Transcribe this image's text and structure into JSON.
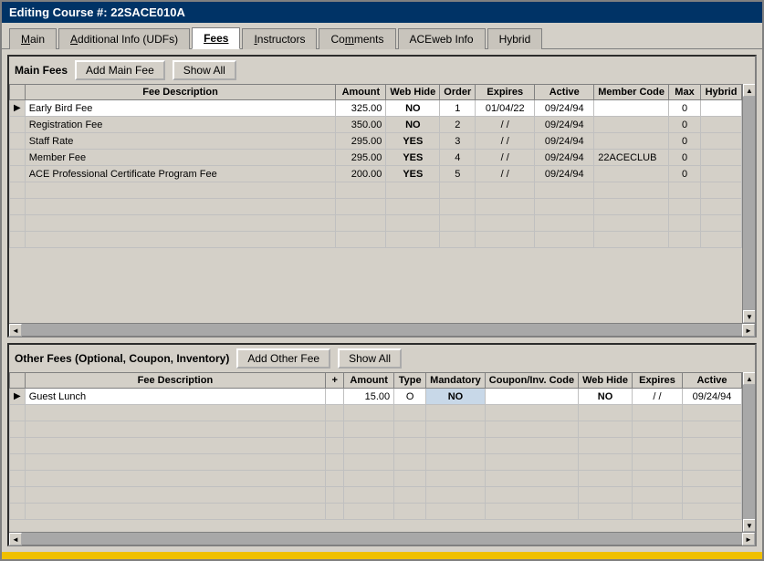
{
  "window": {
    "title": "Editing Course #: 22SACE010A"
  },
  "tabs": [
    {
      "label": "Main",
      "underline": true,
      "active": false
    },
    {
      "label": "Additional Info (UDFs)",
      "underline": true,
      "active": false
    },
    {
      "label": "Fees",
      "underline": true,
      "active": true
    },
    {
      "label": "Instructors",
      "underline": true,
      "active": false
    },
    {
      "label": "Comments",
      "underline": true,
      "active": false
    },
    {
      "label": "ACEweb Info",
      "underline": true,
      "active": false
    },
    {
      "label": "Hybrid",
      "underline": true,
      "active": false
    }
  ],
  "main_fees": {
    "section_title": "Main Fees",
    "add_button": "Add Main Fee",
    "show_all_button": "Show All",
    "columns": [
      "Fee Description",
      "Amount",
      "Web Hide",
      "Order",
      "Expires",
      "Active",
      "Member Code",
      "Max",
      "Hybrid"
    ],
    "rows": [
      {
        "indicator": "▶",
        "active": true,
        "description": "Early Bird Fee",
        "amount": "325.00",
        "web_hide": "NO",
        "order": "1",
        "expires": "01/04/22",
        "active_date": "09/24/94",
        "member_code": "",
        "max": "0",
        "hybrid": ""
      },
      {
        "indicator": "",
        "active": false,
        "description": "Registration Fee",
        "amount": "350.00",
        "web_hide": "NO",
        "order": "2",
        "expires": "/ /",
        "active_date": "09/24/94",
        "member_code": "",
        "max": "0",
        "hybrid": ""
      },
      {
        "indicator": "",
        "active": false,
        "description": "Staff Rate",
        "amount": "295.00",
        "web_hide": "YES",
        "order": "3",
        "expires": "/ /",
        "active_date": "09/24/94",
        "member_code": "",
        "max": "0",
        "hybrid": ""
      },
      {
        "indicator": "",
        "active": false,
        "description": "Member Fee",
        "amount": "295.00",
        "web_hide": "YES",
        "order": "4",
        "expires": "/ /",
        "active_date": "09/24/94",
        "member_code": "22ACECLUB",
        "max": "0",
        "hybrid": ""
      },
      {
        "indicator": "",
        "active": false,
        "description": "ACE Professional Certificate Program Fee",
        "amount": "200.00",
        "web_hide": "YES",
        "order": "5",
        "expires": "/ /",
        "active_date": "09/24/94",
        "member_code": "",
        "max": "0",
        "hybrid": ""
      },
      {
        "indicator": "",
        "active": false,
        "description": "",
        "amount": "",
        "web_hide": "",
        "order": "",
        "expires": "",
        "active_date": "",
        "member_code": "",
        "max": "",
        "hybrid": ""
      },
      {
        "indicator": "",
        "active": false,
        "description": "",
        "amount": "",
        "web_hide": "",
        "order": "",
        "expires": "",
        "active_date": "",
        "member_code": "",
        "max": "",
        "hybrid": ""
      },
      {
        "indicator": "",
        "active": false,
        "description": "",
        "amount": "",
        "web_hide": "",
        "order": "",
        "expires": "",
        "active_date": "",
        "member_code": "",
        "max": "",
        "hybrid": ""
      },
      {
        "indicator": "",
        "active": false,
        "description": "",
        "amount": "",
        "web_hide": "",
        "order": "",
        "expires": "",
        "active_date": "",
        "member_code": "",
        "max": "",
        "hybrid": ""
      }
    ]
  },
  "other_fees": {
    "section_title": "Other Fees (Optional, Coupon, Inventory)",
    "add_button": "Add Other Fee",
    "show_all_button": "Show All",
    "columns": [
      "Fee Description",
      "+",
      "Amount",
      "Type",
      "Mandatory",
      "Coupon/Inv. Code",
      "Web Hide",
      "Expires",
      "Active"
    ],
    "rows": [
      {
        "indicator": "▶",
        "active": true,
        "description": "Guest Lunch",
        "plus": "",
        "amount": "15.00",
        "type": "O",
        "mandatory": "NO",
        "coupon_code": "",
        "web_hide": "NO",
        "expires": "/ /",
        "active_date": "09/24/94"
      },
      {
        "indicator": "",
        "active": false,
        "description": "",
        "plus": "",
        "amount": "",
        "type": "",
        "mandatory": "",
        "coupon_code": "",
        "web_hide": "",
        "expires": "",
        "active_date": ""
      },
      {
        "indicator": "",
        "active": false,
        "description": "",
        "plus": "",
        "amount": "",
        "type": "",
        "mandatory": "",
        "coupon_code": "",
        "web_hide": "",
        "expires": "",
        "active_date": ""
      },
      {
        "indicator": "",
        "active": false,
        "description": "",
        "plus": "",
        "amount": "",
        "type": "",
        "mandatory": "",
        "coupon_code": "",
        "web_hide": "",
        "expires": "",
        "active_date": ""
      },
      {
        "indicator": "",
        "active": false,
        "description": "",
        "plus": "",
        "amount": "",
        "type": "",
        "mandatory": "",
        "coupon_code": "",
        "web_hide": "",
        "expires": "",
        "active_date": ""
      },
      {
        "indicator": "",
        "active": false,
        "description": "",
        "plus": "",
        "amount": "",
        "type": "",
        "mandatory": "",
        "coupon_code": "",
        "web_hide": "",
        "expires": "",
        "active_date": ""
      },
      {
        "indicator": "",
        "active": false,
        "description": "",
        "plus": "",
        "amount": "",
        "type": "",
        "mandatory": "",
        "coupon_code": "",
        "web_hide": "",
        "expires": "",
        "active_date": ""
      },
      {
        "indicator": "",
        "active": false,
        "description": "",
        "plus": "",
        "amount": "",
        "type": "",
        "mandatory": "",
        "coupon_code": "",
        "web_hide": "",
        "expires": "",
        "active_date": ""
      }
    ]
  }
}
